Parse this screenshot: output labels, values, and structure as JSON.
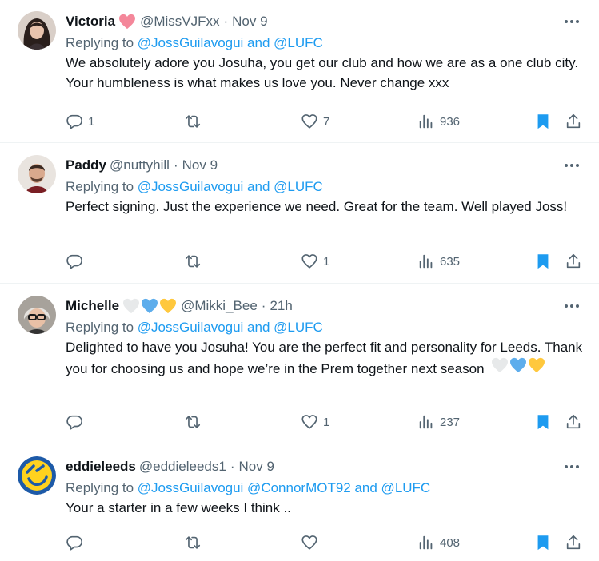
{
  "colors": {
    "accent": "#1d9bf0",
    "muted": "#536471",
    "text": "#0f1419",
    "heart_pink": "#f4879a",
    "heart_white": "#e7e9ea",
    "heart_blue": "#5dadec",
    "heart_yellow": "#ffc83d"
  },
  "replying_label": "Replying to",
  "tweets": [
    {
      "name": "Victoria",
      "name_emoji": [
        "heart_pink"
      ],
      "handle": "@MissVJFxx",
      "time": "Nov 9",
      "reply_to": "@JossGuilavogui and @LUFC",
      "text": "We absolutely adore you Josuha, you get our club and how we are as a one club city. Your humbleness is what makes us love you. Never change xxx",
      "text_emoji": [],
      "reply_count": "1",
      "retweet_count": "",
      "like_count": "7",
      "view_count": "936",
      "avatar_icon": "avatar-photo-icon"
    },
    {
      "name": "Paddy",
      "name_emoji": [],
      "handle": "@nuttyhill",
      "time": "Nov 9",
      "reply_to": "@JossGuilavogui and @LUFC",
      "text": "Perfect signing. Just the experience we need. Great for the team. Well played Joss!",
      "text_emoji": [],
      "reply_count": "",
      "retweet_count": "",
      "like_count": "1",
      "view_count": "635",
      "avatar_icon": "avatar-photo-icon"
    },
    {
      "name": "Michelle",
      "name_emoji": [
        "heart_white",
        "heart_blue",
        "heart_yellow"
      ],
      "handle": "@Mikki_Bee",
      "time": "21h",
      "reply_to": "@JossGuilavogui and @LUFC",
      "text": "Delighted to have you Josuha!  You are the perfect fit and personality for Leeds.  Thank you for choosing us and hope we’re in the Prem together next season",
      "text_emoji": [
        "heart_white",
        "heart_blue",
        "heart_yellow"
      ],
      "reply_count": "",
      "retweet_count": "",
      "like_count": "1",
      "view_count": "237",
      "avatar_icon": "avatar-photo-icon"
    },
    {
      "name": "eddieleeds",
      "name_emoji": [],
      "handle": "@eddieleeds1",
      "time": "Nov 9",
      "reply_to": "@JossGuilavogui @ConnorMOT92 and @LUFC",
      "text": "Your a starter in a few weeks I think ..",
      "text_emoji": [],
      "reply_count": "",
      "retweet_count": "",
      "like_count": "",
      "view_count": "408",
      "avatar_icon": "smiley-badge-icon"
    }
  ]
}
